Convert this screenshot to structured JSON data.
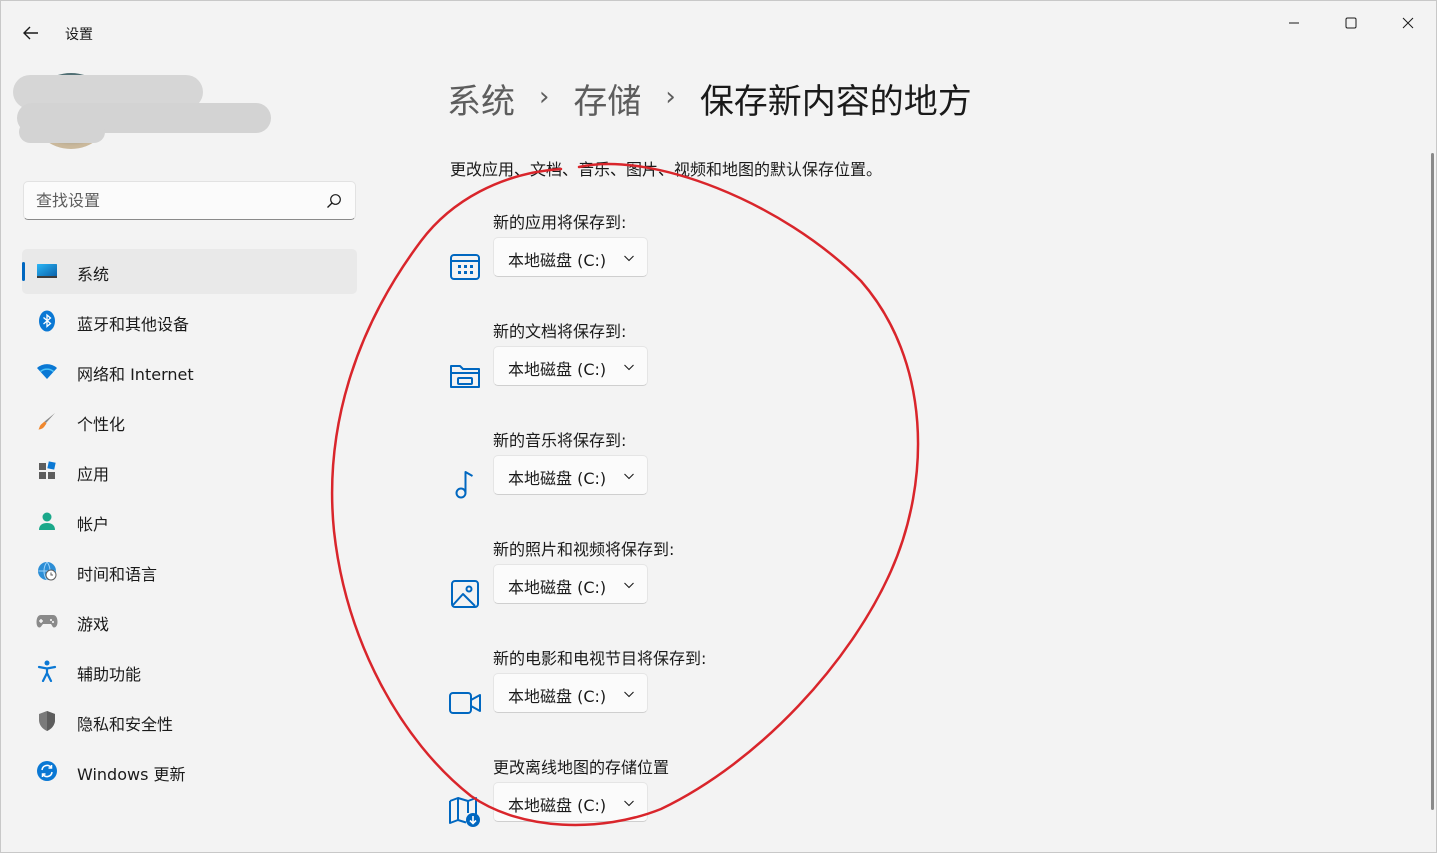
{
  "window": {
    "title": "设置",
    "controls": [
      "minimize",
      "maximize",
      "close"
    ]
  },
  "search": {
    "placeholder": "查找设置",
    "icon": "search-icon"
  },
  "sidebar": {
    "items": [
      {
        "label": "系统",
        "icon": "monitor-icon",
        "selected": true
      },
      {
        "label": "蓝牙和其他设备",
        "icon": "bluetooth-icon"
      },
      {
        "label": "网络和 Internet",
        "icon": "wifi-icon"
      },
      {
        "label": "个性化",
        "icon": "brush-icon"
      },
      {
        "label": "应用",
        "icon": "apps-icon"
      },
      {
        "label": "帐户",
        "icon": "account-icon"
      },
      {
        "label": "时间和语言",
        "icon": "globe-clock-icon"
      },
      {
        "label": "游戏",
        "icon": "gamepad-icon"
      },
      {
        "label": "辅助功能",
        "icon": "accessibility-icon"
      },
      {
        "label": "隐私和安全性",
        "icon": "shield-icon"
      },
      {
        "label": "Windows 更新",
        "icon": "update-icon"
      }
    ]
  },
  "breadcrumb": {
    "items": [
      "系统",
      "存储",
      "保存新内容的地方"
    ],
    "separator": "›"
  },
  "main": {
    "description": "更改应用、文档、音乐、图片、视频和地图的默认保存位置。",
    "settings": [
      {
        "label": "新的应用将保存到:",
        "value": "本地磁盘 (C:)",
        "icon": "apps-grid-icon"
      },
      {
        "label": "新的文档将保存到:",
        "value": "本地磁盘 (C:)",
        "icon": "folder-icon"
      },
      {
        "label": "新的音乐将保存到:",
        "value": "本地磁盘 (C:)",
        "icon": "music-note-icon"
      },
      {
        "label": "新的照片和视频将保存到:",
        "value": "本地磁盘 (C:)",
        "icon": "picture-icon"
      },
      {
        "label": "新的电影和电视节目将保存到:",
        "value": "本地磁盘 (C:)",
        "icon": "video-camera-icon"
      },
      {
        "label": "更改离线地图的存储位置",
        "value": "本地磁盘 (C:)",
        "icon": "map-download-icon"
      }
    ]
  },
  "colors": {
    "accent": "#0067c0",
    "annotation": "#d9252b",
    "background": "#f3f3f3"
  }
}
